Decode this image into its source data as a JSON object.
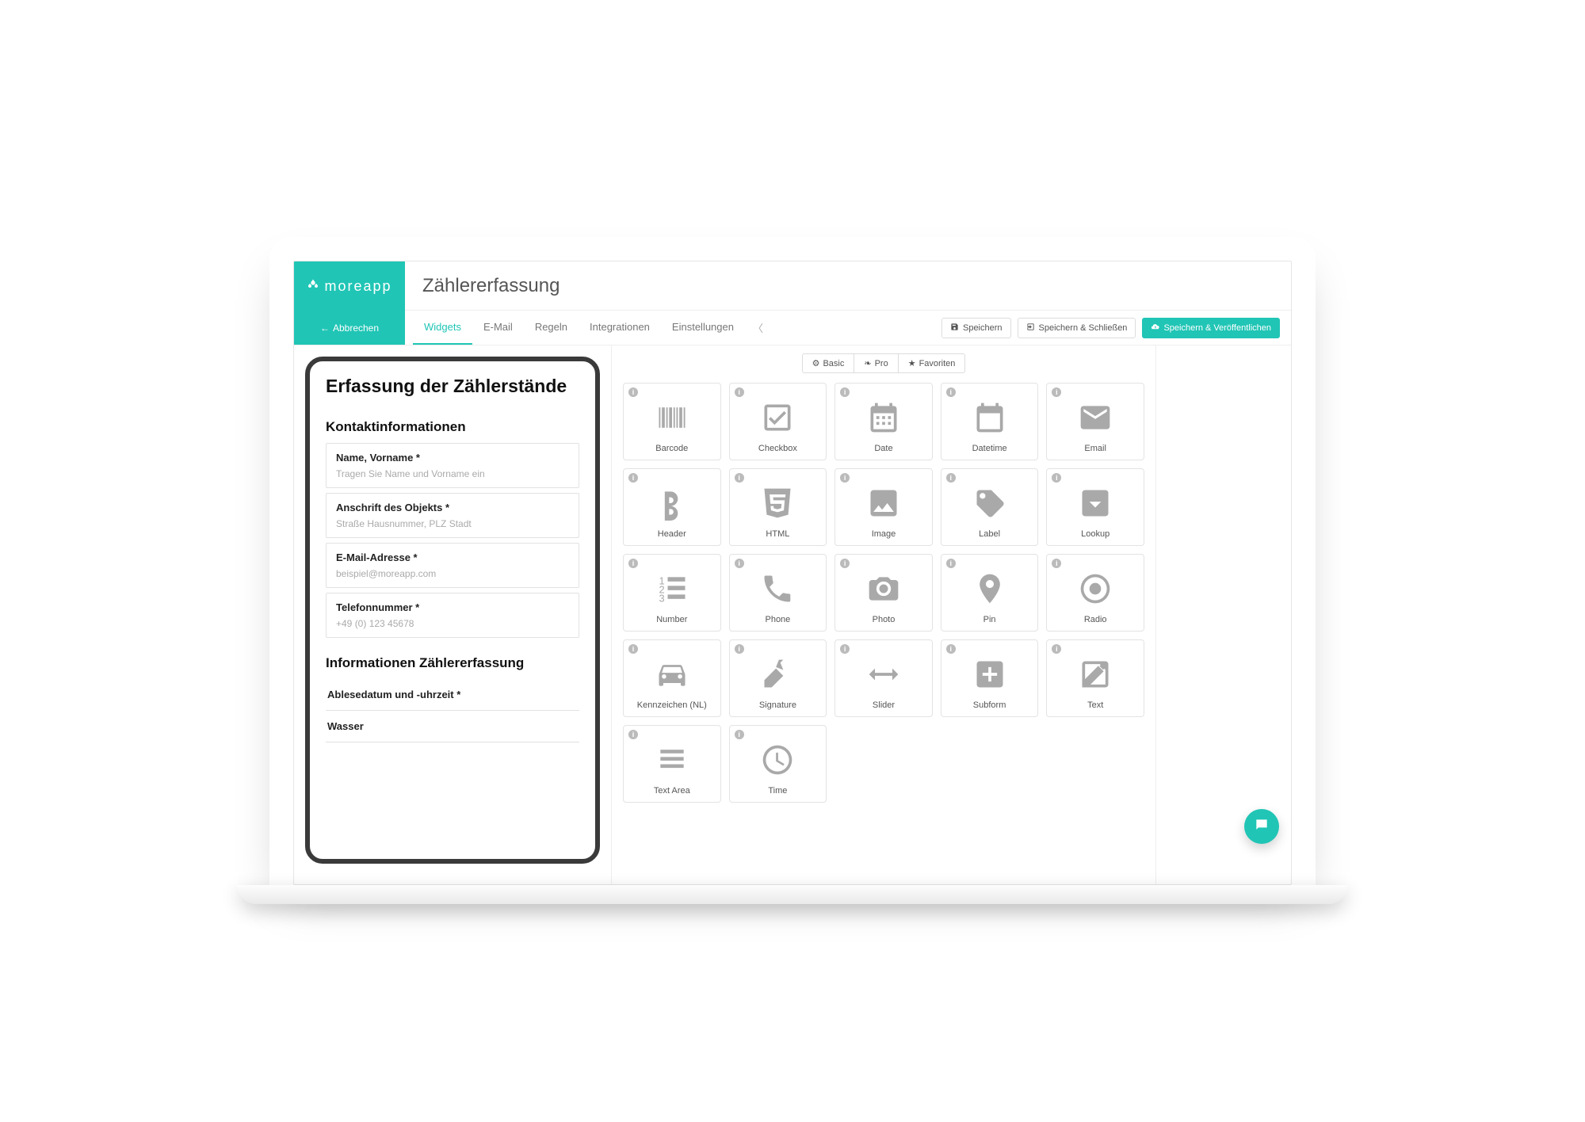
{
  "brand": "moreapp",
  "page_title": "Zählererfassung",
  "cancel_label": "Abbrechen",
  "tabs": [
    "Widgets",
    "E-Mail",
    "Regeln",
    "Integrationen",
    "Einstellungen"
  ],
  "active_tab_index": 0,
  "actions": {
    "save": "Speichern",
    "save_close": "Speichern & Schließen",
    "save_publish": "Speichern & Veröffentlichen"
  },
  "filter_tabs": [
    "Basic",
    "Pro",
    "Favoriten"
  ],
  "preview": {
    "title": "Erfassung der Zählerstände",
    "section1": "Kontaktinformationen",
    "fields1": [
      {
        "label": "Name, Vorname *",
        "placeholder": "Tragen Sie Name und Vorname ein"
      },
      {
        "label": "Anschrift des Objekts *",
        "placeholder": "Straße Hausnummer, PLZ Stadt"
      },
      {
        "label": "E-Mail-Adresse *",
        "placeholder": "beispiel@moreapp.com"
      },
      {
        "label": "Telefonnummer *",
        "placeholder": "+49 (0) 123 45678"
      }
    ],
    "section2": "Informationen Zählererfassung",
    "fields2": [
      {
        "label": "Ablesedatum und -uhrzeit *"
      },
      {
        "label": "Wasser"
      }
    ]
  },
  "widgets": [
    {
      "name": "Barcode",
      "icon": "barcode"
    },
    {
      "name": "Checkbox",
      "icon": "checkbox"
    },
    {
      "name": "Date",
      "icon": "date"
    },
    {
      "name": "Datetime",
      "icon": "datetime"
    },
    {
      "name": "Email",
      "icon": "email"
    },
    {
      "name": "Header",
      "icon": "header"
    },
    {
      "name": "HTML",
      "icon": "html"
    },
    {
      "name": "Image",
      "icon": "image"
    },
    {
      "name": "Label",
      "icon": "label"
    },
    {
      "name": "Lookup",
      "icon": "lookup"
    },
    {
      "name": "Number",
      "icon": "number"
    },
    {
      "name": "Phone",
      "icon": "phone"
    },
    {
      "name": "Photo",
      "icon": "photo"
    },
    {
      "name": "Pin",
      "icon": "pin"
    },
    {
      "name": "Radio",
      "icon": "radio"
    },
    {
      "name": "Kennzeichen (NL)",
      "icon": "car"
    },
    {
      "name": "Signature",
      "icon": "signature"
    },
    {
      "name": "Slider",
      "icon": "slider"
    },
    {
      "name": "Subform",
      "icon": "subform"
    },
    {
      "name": "Text",
      "icon": "text"
    },
    {
      "name": "Text Area",
      "icon": "textarea"
    },
    {
      "name": "Time",
      "icon": "time"
    }
  ]
}
